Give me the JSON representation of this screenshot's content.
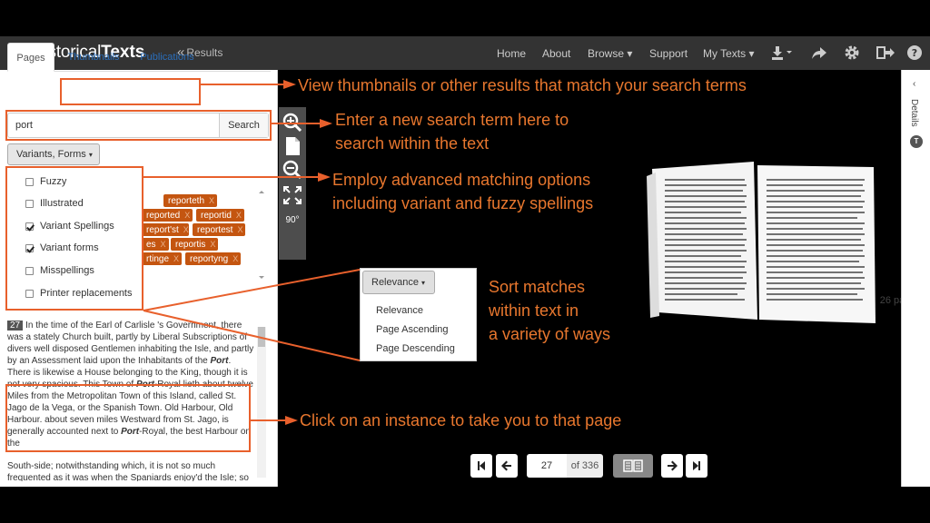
{
  "navbar": {
    "brand_light": "Historical",
    "brand_bold": "Texts",
    "back_label": "Results",
    "items": [
      "Home",
      "About",
      "Browse",
      "Support",
      "My Texts"
    ],
    "caret": "▾"
  },
  "sidebar": {
    "tabs": [
      "Pages",
      "Thumbnails",
      "Publications"
    ],
    "search_value": "port",
    "search_button": "Search",
    "variants_button": "Variants, Forms",
    "options": [
      {
        "label": "Fuzzy",
        "checked": false
      },
      {
        "label": "Illustrated",
        "checked": false
      },
      {
        "label": "Variant Spellings",
        "checked": true
      },
      {
        "label": "Variant forms",
        "checked": true
      },
      {
        "label": "Misspellings",
        "checked": false
      },
      {
        "label": "Printer replacements",
        "checked": false
      }
    ],
    "chips": [
      "reporteth",
      "reported",
      "reportid",
      "report'st",
      "reportest",
      "es",
      "reportis",
      "rtinge",
      "reportyng"
    ],
    "chip_close": "X",
    "page_count": "26 pages",
    "result": {
      "page_number": "27",
      "text_before": "In the time of the Earl of Carlisle 's Government, there was a stately Church built, partly by Liberal Subscriptions of divers well disposed Gentlemen inhabiting the Isle, and partly by an Assessment laid upon the Inhabitants of the ",
      "term1": "Port",
      "text_mid": ". There is likewise a House belonging to the King, though it is not very spacious. This Town of ",
      "term2": "Port",
      "text_mid2": "-Royal lieth about twelve Miles from the Metropolitan Town of this Island, called St. Jago de la Vega, or the Spanish Town. Old Harbour, Old Harbour. about seven miles Westward from St. Jago, is generally accounted next to ",
      "term3": "Port",
      "text_end": "-Royal, the best Harbour on the",
      "next_text": "South-side; notwithstanding which, it is not so much frequented as it was when the Spaniards enjoy'd the Isle; so"
    }
  },
  "toolbar": {
    "rotate_label": "90°"
  },
  "sort_menu": {
    "button": "Relevance",
    "items": [
      "Relevance",
      "Page Ascending",
      "Page Descending"
    ]
  },
  "pager": {
    "current": "27",
    "of_label": "of 336"
  },
  "right_rail": {
    "label": "Details",
    "badge": "T"
  },
  "annotations": {
    "thumbnails": "View thumbnails or other results that match your search terms",
    "search_line1": "Enter a new search term here to",
    "search_line2": "search within the text",
    "advanced_line1": "Employ advanced matching options",
    "advanced_line2": "including variant and fuzzy spellings",
    "sort_line1": "Sort matches",
    "sort_line2": "within text in",
    "sort_line3": "a variety of ways",
    "instance": "Click on an instance to take you to that page"
  },
  "colors": {
    "accent": "#e8602c",
    "chip": "#c45510",
    "navbar": "#333333"
  }
}
